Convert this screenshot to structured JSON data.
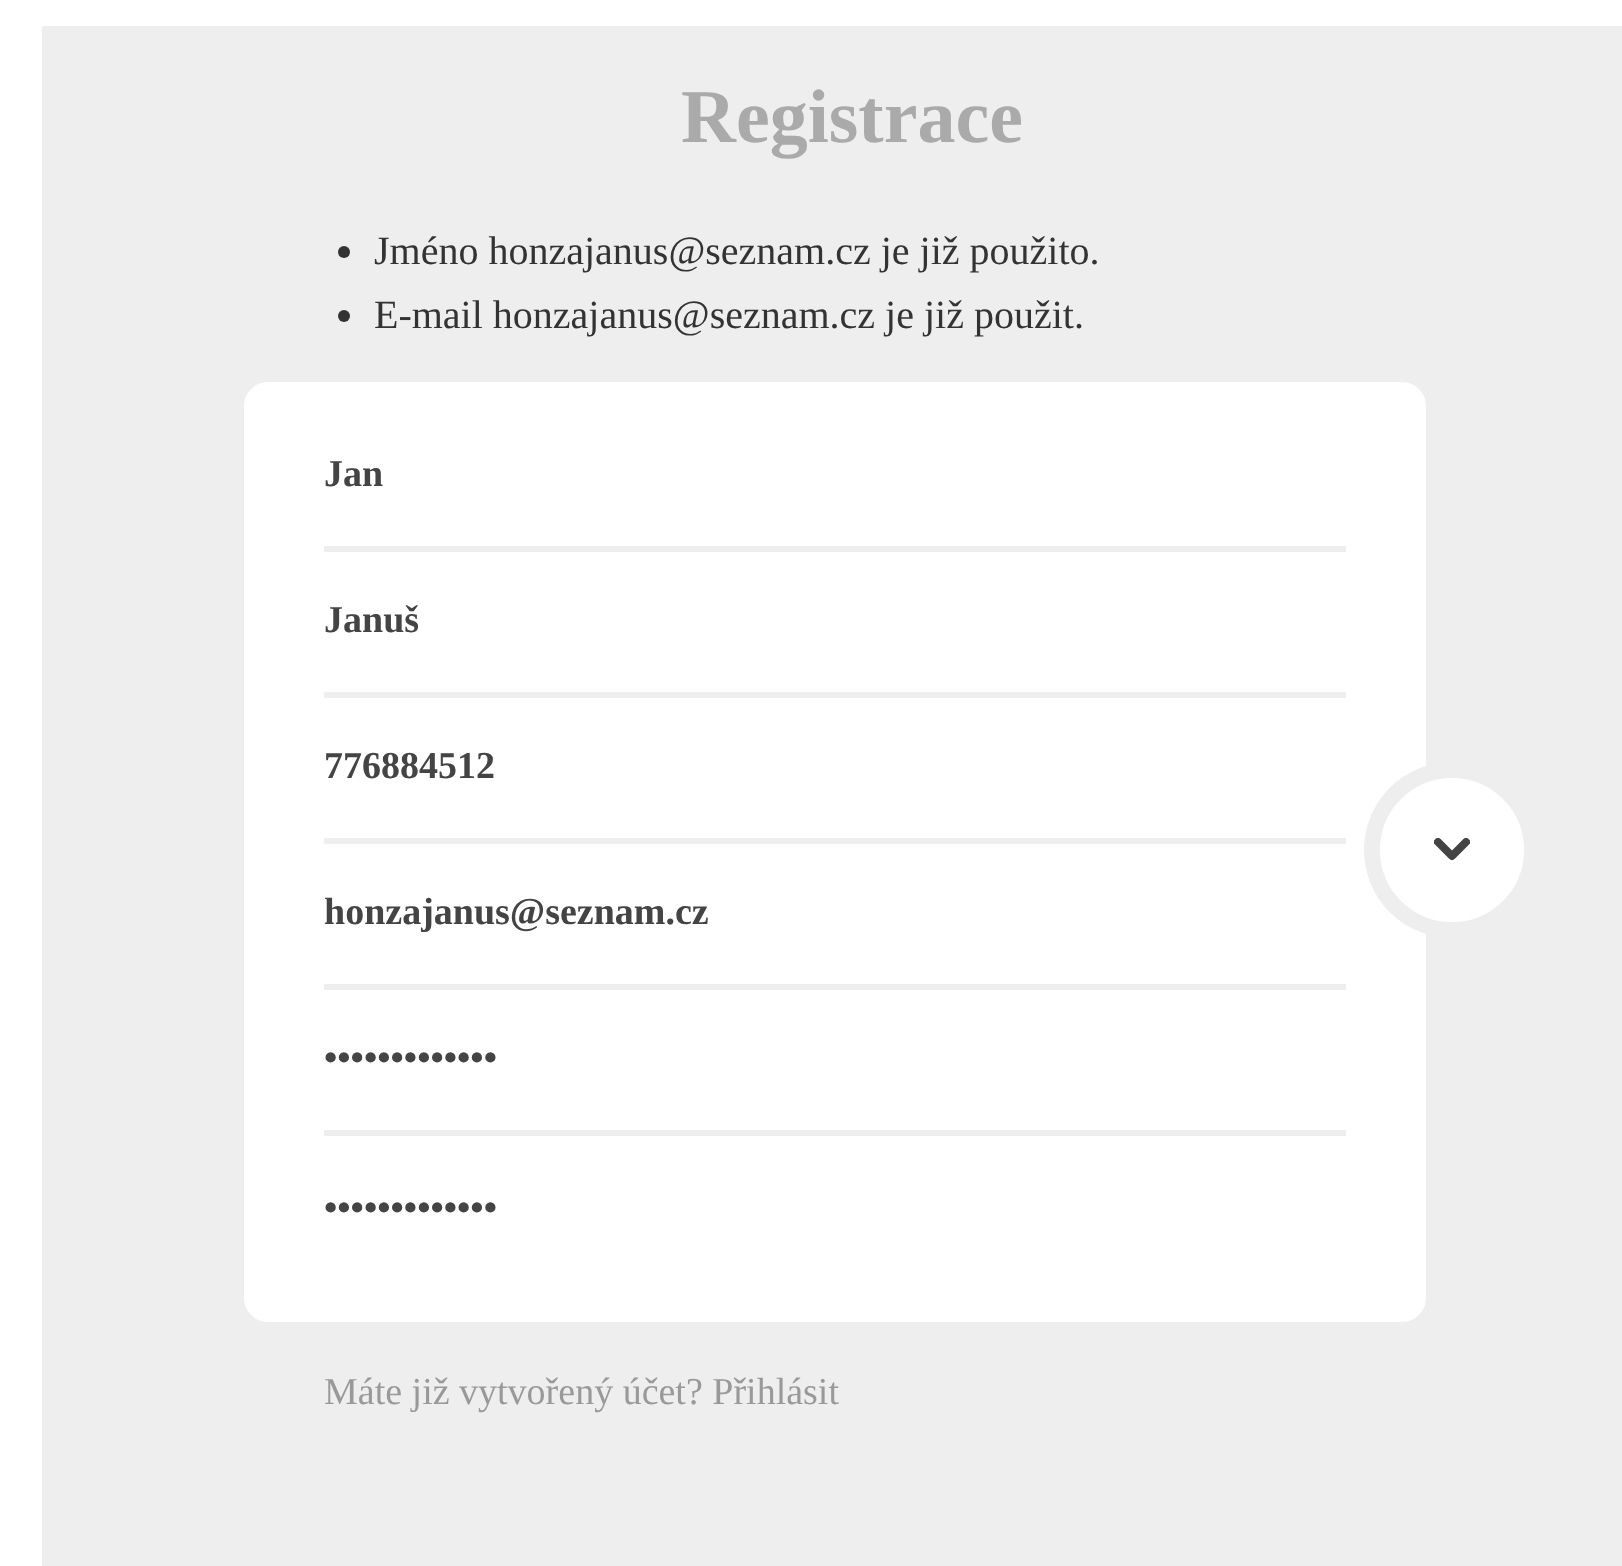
{
  "title": "Registrace",
  "errors": [
    "Jméno honzajanus@seznam.cz je již použito.",
    "E-mail honzajanus@seznam.cz je již použit."
  ],
  "fields": [
    {
      "value": "Jan"
    },
    {
      "value": "Januš"
    },
    {
      "value": "776884512"
    },
    {
      "value": "honzajanus@seznam.cz"
    },
    {
      "value": "•••••••••••••"
    },
    {
      "value": "•••••••••••••"
    }
  ],
  "footer": {
    "text": "Máte již vytvořený účet?",
    "link": "Přihlásit"
  }
}
